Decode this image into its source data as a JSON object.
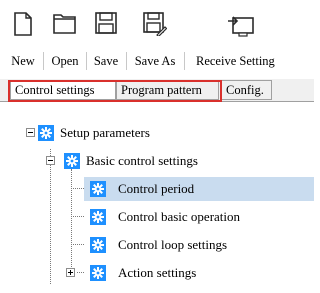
{
  "toolbar": {
    "new_label": "New",
    "open_label": "Open",
    "save_label": "Save",
    "save_as_label": "Save As",
    "receive_label": "Receive Setting"
  },
  "tabs": [
    {
      "label": "Control settings",
      "active": true
    },
    {
      "label": "Program pattern",
      "active": false
    },
    {
      "label": "Config.",
      "active": false
    }
  ],
  "tree": {
    "root": "Setup parameters",
    "group": "Basic control settings",
    "items": [
      {
        "label": "Control period",
        "selected": true
      },
      {
        "label": "Control basic operation",
        "selected": false
      },
      {
        "label": "Control loop settings",
        "selected": false
      },
      {
        "label": "Action settings",
        "selected": false
      }
    ]
  },
  "colors": {
    "highlight_border": "#d9302c",
    "selection": "#c9dcef",
    "gear_icon": "#1e90ff"
  },
  "icons": [
    "new-file-icon",
    "open-folder-icon",
    "save-disk-icon",
    "save-as-icon",
    "receive-setting-icon",
    "gear-icon"
  ]
}
